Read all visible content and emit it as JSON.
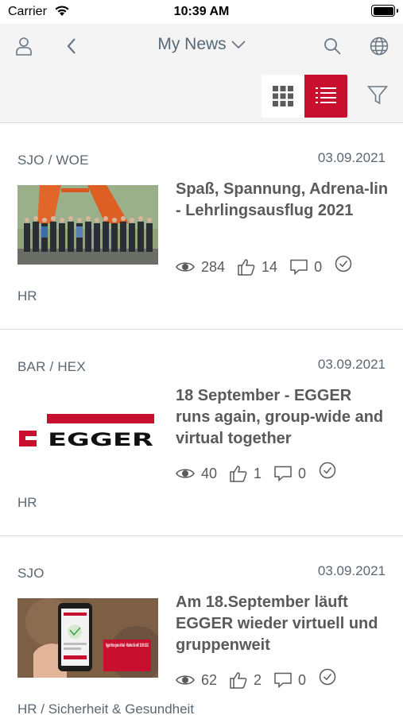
{
  "status_bar": {
    "carrier": "Carrier",
    "time": "10:39 AM"
  },
  "header": {
    "title": "My News"
  },
  "icons": {
    "user": "user-icon",
    "back": "chevron-left-icon",
    "title_dropdown": "chevron-down-icon",
    "search": "search-icon",
    "globe": "globe-icon",
    "grid_view": "grid-icon",
    "list_view": "list-icon",
    "filter": "filter-icon",
    "views": "eye-icon",
    "likes": "thumbs-up-icon",
    "comments": "comment-icon",
    "read": "check-circle-icon"
  },
  "colors": {
    "accent": "#c8102e",
    "text_secondary": "#5b6670",
    "header_bg": "#f4f4f4"
  },
  "articles": [
    {
      "tag": "SJO / WOE",
      "date": "03.09.2021",
      "headline": "Spaß, Spannung, Adrena-lin - Lehrlingsausflug 2021",
      "views": "284",
      "likes": "14",
      "comments": "0",
      "category": "HR"
    },
    {
      "tag": "BAR / HEX",
      "date": "03.09.2021",
      "headline": "18 September - EGGER runs again, group-wide and virtual together",
      "views": "40",
      "likes": "1",
      "comments": "0",
      "category": "HR",
      "logo_text": "EGGER"
    },
    {
      "tag": "SJO",
      "date": "03.09.2021",
      "headline": "Am 18.September läuft EGGER wieder virtuell und gruppenweit",
      "views": "62",
      "likes": "2",
      "comments": "0",
      "category": "HR / Sicherheit & Gesundheit",
      "promo_text": "Egger Runs goes virtual – Machen Sie mit! 18.09.2021"
    }
  ]
}
